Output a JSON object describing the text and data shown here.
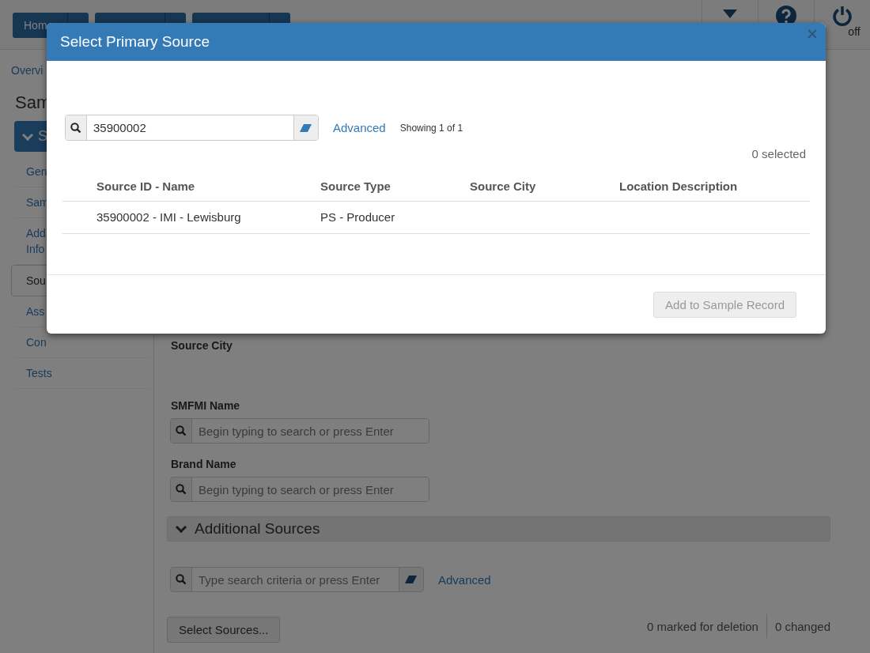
{
  "header": {
    "nav_buttons": [
      {
        "label": "Hom"
      }
    ],
    "logoff_label": "off"
  },
  "breadcrumb": "Overvi",
  "page_title": "Sam",
  "section_button": {
    "label": "S",
    "expanded": true
  },
  "sidebar_items": [
    {
      "label": "Gen",
      "selected": false
    },
    {
      "label": "Sam",
      "selected": false
    },
    {
      "label": "Add Info",
      "selected": false
    },
    {
      "label": "Sou",
      "selected": true
    },
    {
      "label": "Ass",
      "selected": false
    },
    {
      "label": "Con",
      "selected": false
    },
    {
      "label": "Tests",
      "selected": false
    }
  ],
  "main": {
    "source_city_label": "Source City",
    "fields": [
      {
        "label": "SMFMI Name",
        "placeholder": "Begin typing to search or press Enter"
      },
      {
        "label": "Brand Name",
        "placeholder": "Begin typing to search or press Enter"
      }
    ],
    "additional_sources": {
      "title": "Additional Sources",
      "expanded": true,
      "search_placeholder": "Type search criteria or press Enter",
      "advanced_link": "Advanced",
      "select_button": "Select Sources...",
      "marked_for_deletion": "0 marked for deletion",
      "changed": "0 changed"
    }
  },
  "modal": {
    "title": "Select Primary Source",
    "close": "×",
    "search_value": "35900002",
    "advanced_link": "Advanced",
    "showing": "Showing 1 of 1",
    "selected_count": "0 selected",
    "columns": [
      "Source ID - Name",
      "Source Type",
      "Source City",
      "Location Description"
    ],
    "rows": [
      [
        "35900002 - IMI - Lewisburg",
        "PS - Producer",
        "",
        ""
      ]
    ],
    "add_button": {
      "label": "Add to Sample Record",
      "disabled": true
    }
  }
}
